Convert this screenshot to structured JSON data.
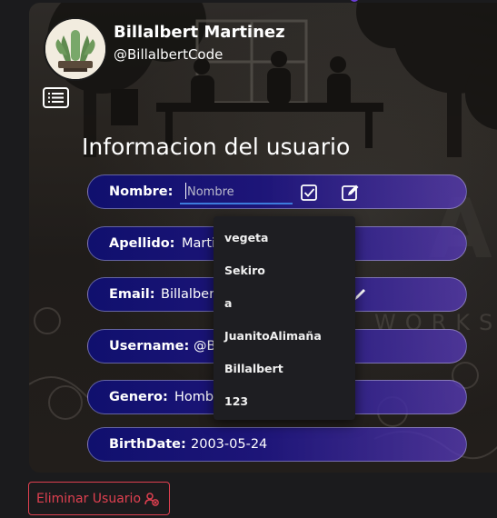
{
  "profile": {
    "name": "Billalbert Martinez",
    "handle": "@BillalbertCode"
  },
  "section": {
    "title": "Informacion del usuario"
  },
  "fields": {
    "nombre": {
      "label": "Nombre:",
      "placeholder": "Nombre"
    },
    "apellido": {
      "label": "Apellido:",
      "value": "Marti"
    },
    "email": {
      "label": "Email:",
      "value": "Billalbert"
    },
    "username": {
      "label": "Username:",
      "value": "@B"
    },
    "genero": {
      "label": "Genero:",
      "value": "Homb"
    },
    "birthdate": {
      "label": "BirthDate:",
      "value": "2003-05-24"
    }
  },
  "suggestions": [
    "vegeta",
    "Sekiro",
    "a",
    "JuanitoAlimaña",
    "Billalbert",
    "123"
  ],
  "actions": {
    "delete_label": "Eliminar Usuario"
  },
  "colors": {
    "accent": "#3d7bdc",
    "danger": "#e04050",
    "field_gradient_start": "#10106e",
    "field_gradient_end": "#5a3cbe"
  }
}
